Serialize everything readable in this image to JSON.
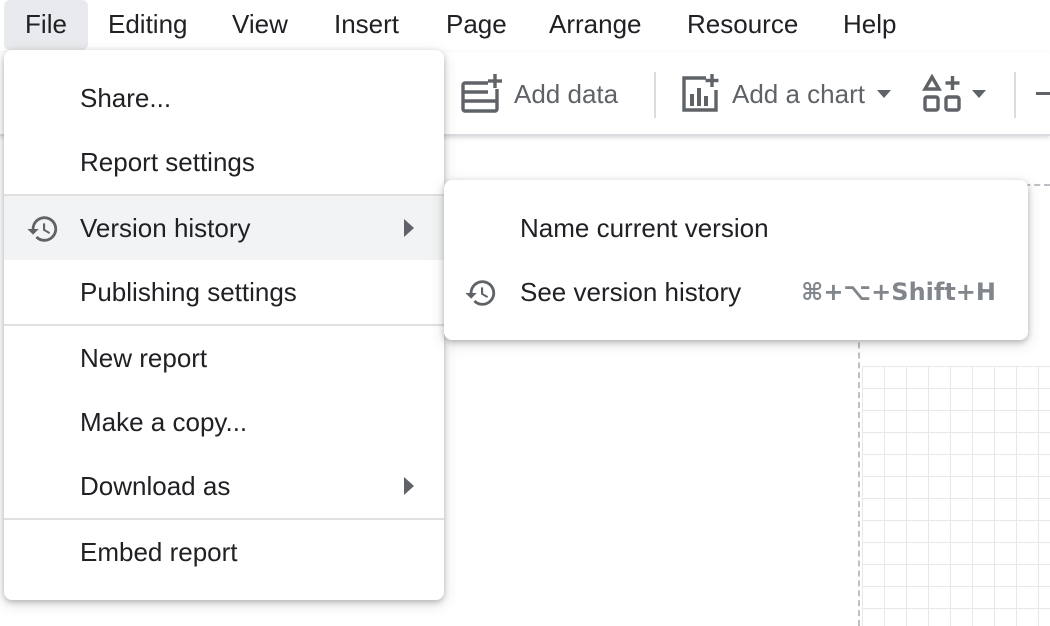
{
  "menubar": {
    "items": [
      "File",
      "Editing",
      "View",
      "Insert",
      "Page",
      "Arrange",
      "Resource",
      "Help"
    ]
  },
  "toolbar": {
    "add_data_label": "Add data",
    "add_chart_label": "Add a chart"
  },
  "file_menu": {
    "share": "Share...",
    "report_settings": "Report settings",
    "version_history": "Version history",
    "publishing_settings": "Publishing settings",
    "new_report": "New report",
    "make_copy": "Make a copy...",
    "download_as": "Download as",
    "embed_report": "Embed report"
  },
  "version_submenu": {
    "name_current_version": "Name current version",
    "see_version_history": "See version history",
    "see_version_history_shortcut": "⌘+⌥+Shift+H"
  },
  "colors": {
    "text": "#202124",
    "icon_gray": "#5f6368",
    "active_bg": "#e8eaed",
    "hover_bg": "#f1f3f4"
  }
}
